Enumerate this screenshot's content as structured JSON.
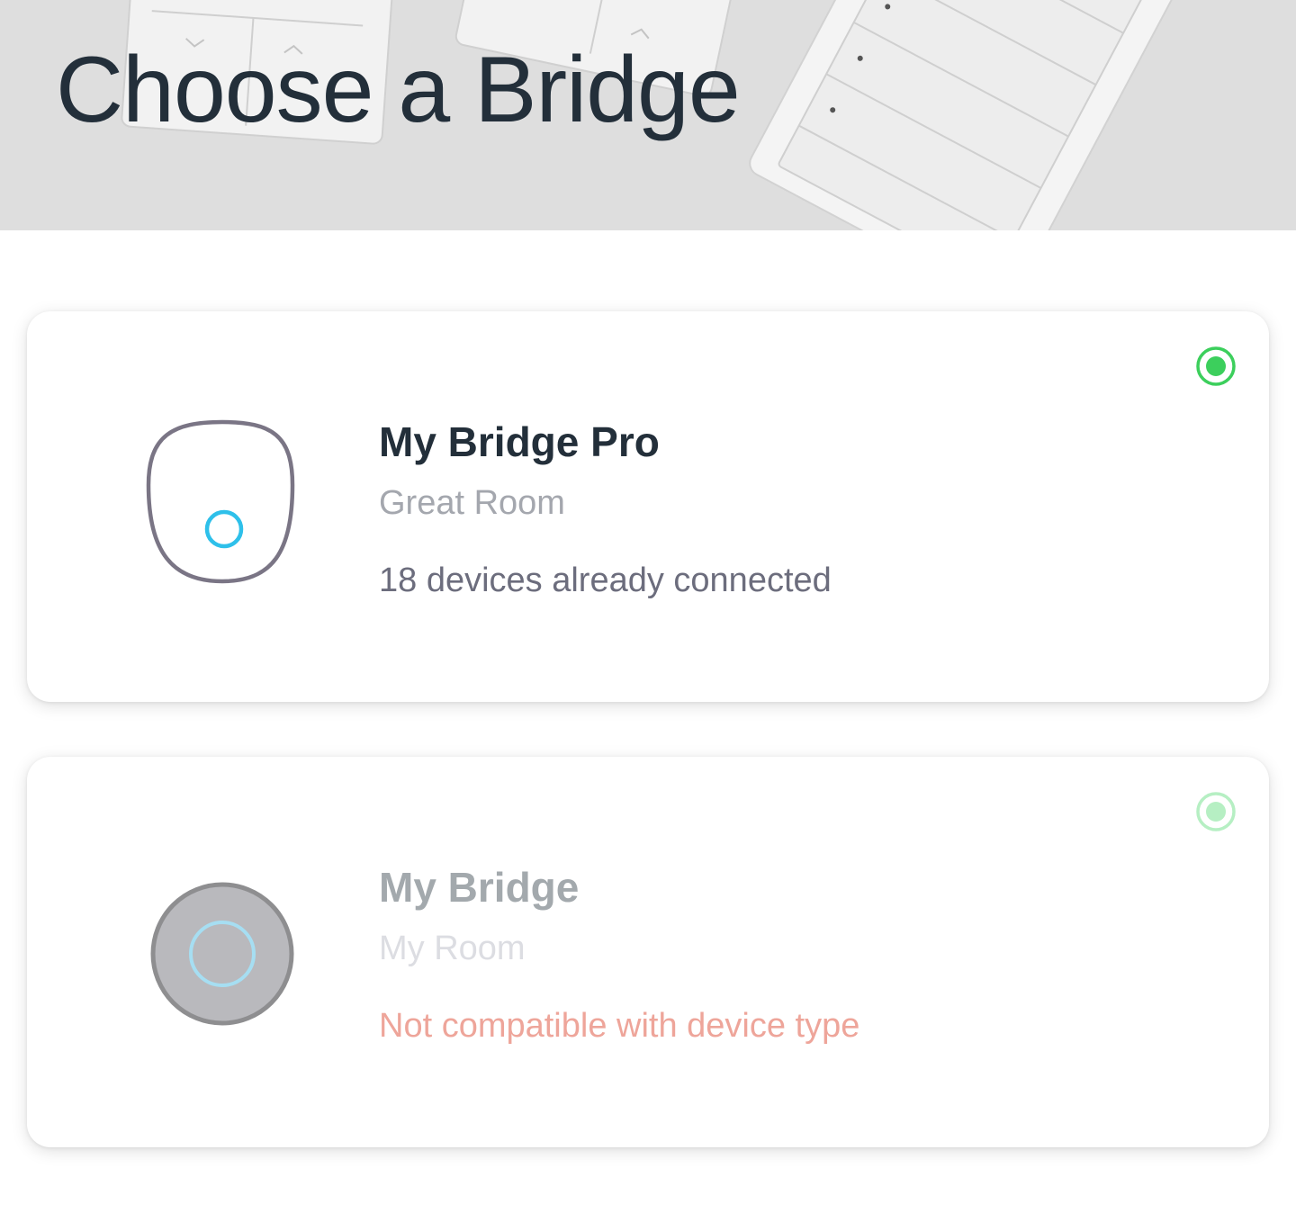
{
  "header": {
    "title": "Choose a Bridge"
  },
  "bridges": [
    {
      "name": "My Bridge Pro",
      "room": "Great Room",
      "status": "18 devices already connected",
      "icon": "bridge-pro-icon",
      "selected": true,
      "compatible": true
    },
    {
      "name": "My Bridge",
      "room": "My Room",
      "status": "Not compatible with device type",
      "icon": "bridge-icon",
      "selected": false,
      "compatible": false
    }
  ],
  "colors": {
    "title": "#232f3a",
    "radio_active": "#3ccf5c",
    "radio_disabled": "#b6efc3",
    "status_error": "#eea59a",
    "bridge_light": "#2ec0ea"
  }
}
